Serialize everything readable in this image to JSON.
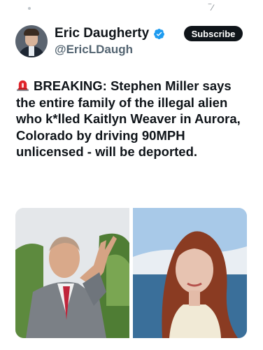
{
  "author": {
    "name": "Eric Daugherty",
    "handle": "@EricLDaugh",
    "verified": true
  },
  "actions": {
    "subscribe_label": "Subscribe"
  },
  "tweet": {
    "emoji": "rotating-light-icon",
    "text": "BREAKING: Stephen Miller says the entire family of the illegal alien who k*lled Kaitlyn Weaver in Aurora, Colorado by driving 90MPH unlicensed - will be deported."
  },
  "media": {
    "images": [
      {
        "description_icon": "man-pointing-photo"
      },
      {
        "description_icon": "woman-portrait-photo"
      }
    ]
  },
  "colors": {
    "verified_blue": "#1d9bf0",
    "handle_gray": "#536471",
    "button_black": "#0f1419"
  }
}
